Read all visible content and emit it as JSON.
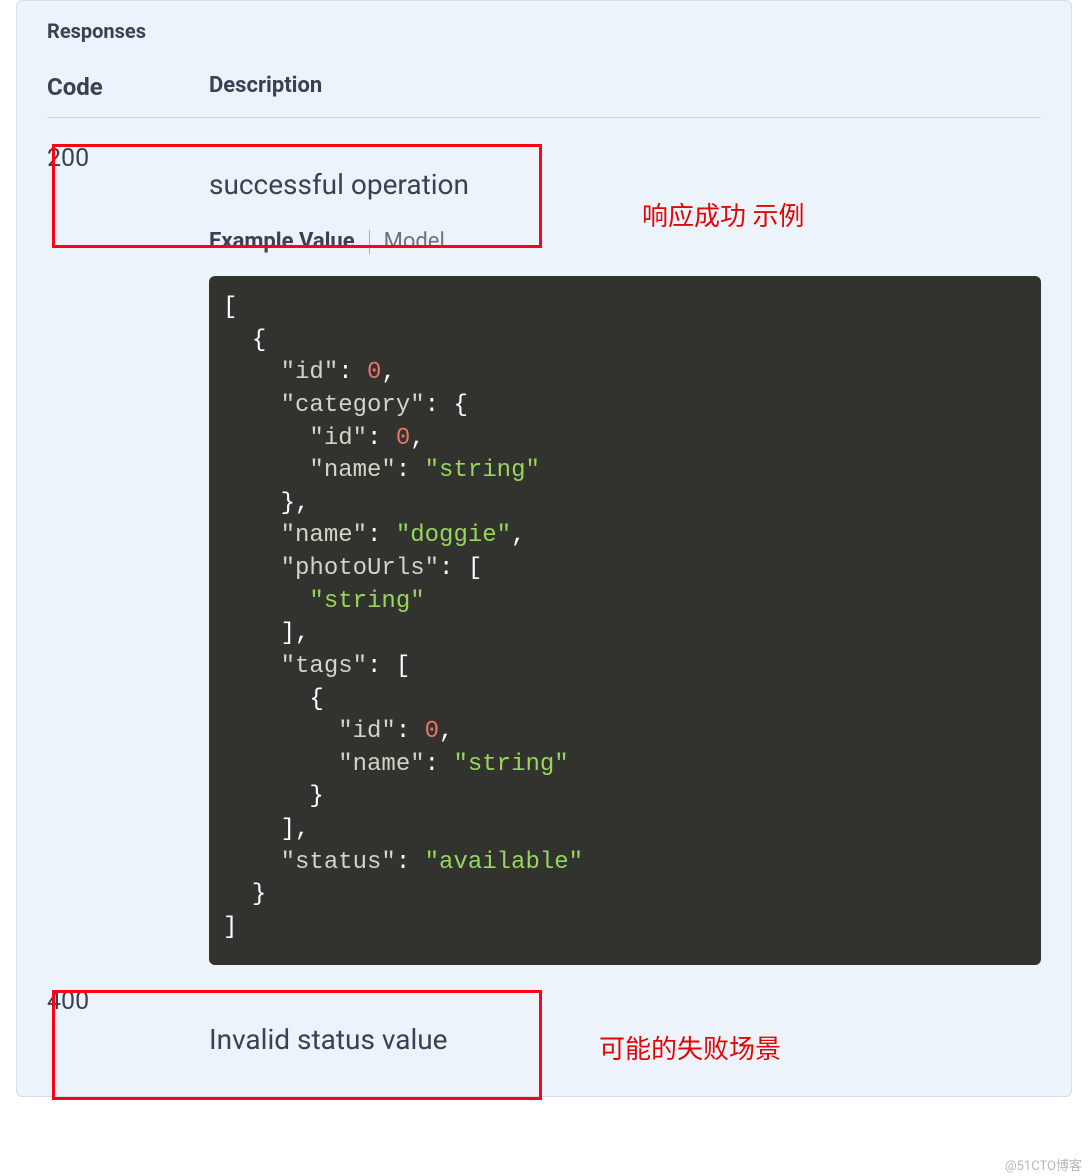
{
  "responses": {
    "section_title": "Responses",
    "head_code": "Code",
    "head_description": "Description",
    "rows": [
      {
        "code": "200",
        "description": "successful operation"
      },
      {
        "code": "400",
        "description": "Invalid status value"
      }
    ],
    "tabs": {
      "example_value": "Example Value",
      "model": "Model"
    },
    "example_json": {
      "raw": "[\n  {\n    \"id\": 0,\n    \"category\": {\n      \"id\": 0,\n      \"name\": \"string\"\n    },\n    \"name\": \"doggie\",\n    \"photoUrls\": [\n      \"string\"\n    ],\n    \"tags\": [\n      {\n        \"id\": 0,\n        \"name\": \"string\"\n      }\n    ],\n    \"status\": \"available\"\n  }\n]",
      "tokens": [
        {
          "t": "[",
          "c": "p"
        },
        {
          "t": "\n  ",
          "c": "p"
        },
        {
          "t": "{",
          "c": "p"
        },
        {
          "t": "\n    ",
          "c": "p"
        },
        {
          "t": "\"id\"",
          "c": "k"
        },
        {
          "t": ": ",
          "c": "p"
        },
        {
          "t": "0",
          "c": "n"
        },
        {
          "t": ",",
          "c": "p"
        },
        {
          "t": "\n    ",
          "c": "p"
        },
        {
          "t": "\"category\"",
          "c": "k"
        },
        {
          "t": ": {",
          "c": "p"
        },
        {
          "t": "\n      ",
          "c": "p"
        },
        {
          "t": "\"id\"",
          "c": "k"
        },
        {
          "t": ": ",
          "c": "p"
        },
        {
          "t": "0",
          "c": "n"
        },
        {
          "t": ",",
          "c": "p"
        },
        {
          "t": "\n      ",
          "c": "p"
        },
        {
          "t": "\"name\"",
          "c": "k"
        },
        {
          "t": ": ",
          "c": "p"
        },
        {
          "t": "\"string\"",
          "c": "s"
        },
        {
          "t": "\n    ",
          "c": "p"
        },
        {
          "t": "},",
          "c": "p"
        },
        {
          "t": "\n    ",
          "c": "p"
        },
        {
          "t": "\"name\"",
          "c": "k"
        },
        {
          "t": ": ",
          "c": "p"
        },
        {
          "t": "\"doggie\"",
          "c": "s"
        },
        {
          "t": ",",
          "c": "p"
        },
        {
          "t": "\n    ",
          "c": "p"
        },
        {
          "t": "\"photoUrls\"",
          "c": "k"
        },
        {
          "t": ": [",
          "c": "p"
        },
        {
          "t": "\n      ",
          "c": "p"
        },
        {
          "t": "\"string\"",
          "c": "s"
        },
        {
          "t": "\n    ",
          "c": "p"
        },
        {
          "t": "],",
          "c": "p"
        },
        {
          "t": "\n    ",
          "c": "p"
        },
        {
          "t": "\"tags\"",
          "c": "k"
        },
        {
          "t": ": [",
          "c": "p"
        },
        {
          "t": "\n      ",
          "c": "p"
        },
        {
          "t": "{",
          "c": "p"
        },
        {
          "t": "\n        ",
          "c": "p"
        },
        {
          "t": "\"id\"",
          "c": "k"
        },
        {
          "t": ": ",
          "c": "p"
        },
        {
          "t": "0",
          "c": "n"
        },
        {
          "t": ",",
          "c": "p"
        },
        {
          "t": "\n        ",
          "c": "p"
        },
        {
          "t": "\"name\"",
          "c": "k"
        },
        {
          "t": ": ",
          "c": "p"
        },
        {
          "t": "\"string\"",
          "c": "s"
        },
        {
          "t": "\n      ",
          "c": "p"
        },
        {
          "t": "}",
          "c": "p"
        },
        {
          "t": "\n    ",
          "c": "p"
        },
        {
          "t": "],",
          "c": "p"
        },
        {
          "t": "\n    ",
          "c": "p"
        },
        {
          "t": "\"status\"",
          "c": "k"
        },
        {
          "t": ": ",
          "c": "p"
        },
        {
          "t": "\"available\"",
          "c": "s"
        },
        {
          "t": "\n  ",
          "c": "p"
        },
        {
          "t": "}",
          "c": "p"
        },
        {
          "t": "\n",
          "c": "p"
        },
        {
          "t": "]",
          "c": "p"
        }
      ]
    }
  },
  "annotations": {
    "success": "响应成功 示例",
    "failure": "可能的失败场景"
  },
  "watermark": "@51CTO博客"
}
